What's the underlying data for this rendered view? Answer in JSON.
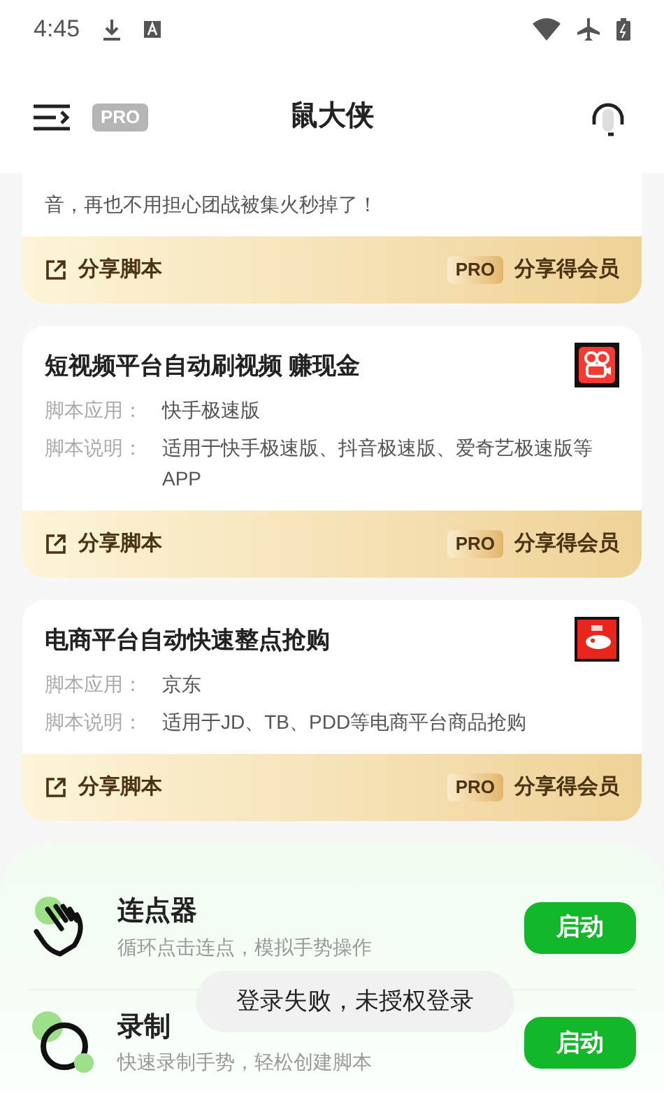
{
  "status_bar": {
    "time": "4:45"
  },
  "header": {
    "pro_badge": "PRO",
    "title": "鼠大侠"
  },
  "scripts": [
    {
      "description": "音，再也不用担心团战被集火秒掉了！",
      "share": "分享脚本",
      "pro_badge": "PRO",
      "member": "分享得会员"
    },
    {
      "title": "短视频平台自动刷视频 赚现金",
      "app_label": "脚本应用：",
      "app": "快手极速版",
      "desc_label": "脚本说明：",
      "description": "适用于快手极速版、抖音极速版、爱奇艺极速版等APP",
      "share": "分享脚本",
      "pro_badge": "PRO",
      "member": "分享得会员"
    },
    {
      "title": "电商平台自动快速整点抢购",
      "app_label": "脚本应用：",
      "app": "京东",
      "desc_label": "脚本说明：",
      "description": "适用于JD、TB、PDD等电商平台商品抢购",
      "share": "分享脚本",
      "pro_badge": "PRO",
      "member": "分享得会员"
    }
  ],
  "tools": [
    {
      "name": "连点器",
      "description": "循环点击连点，模拟手势操作",
      "button": "启动"
    },
    {
      "name": "录制",
      "description": "快速录制手势，轻松创建脚本",
      "button": "启动"
    }
  ],
  "toast": "登录失败，未授权登录"
}
